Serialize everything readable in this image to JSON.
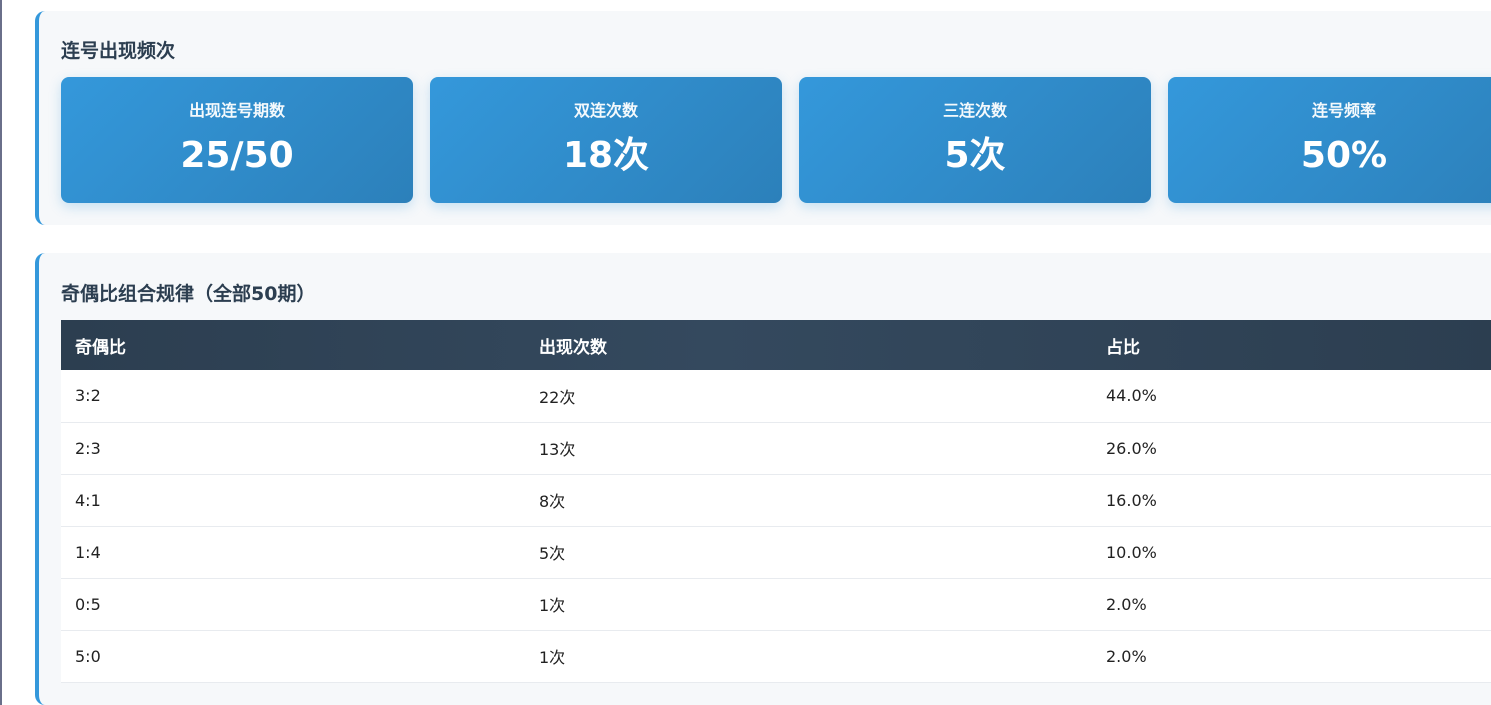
{
  "consecutive": {
    "title": "连号出现频次",
    "cards": [
      {
        "label": "出现连号期数",
        "value": "25/50"
      },
      {
        "label": "双连次数",
        "value": "18次"
      },
      {
        "label": "三连次数",
        "value": "5次"
      },
      {
        "label": "连号频率",
        "value": "50%"
      }
    ]
  },
  "parity": {
    "title": "奇偶比组合规律（全部50期）",
    "headers": [
      "奇偶比",
      "出现次数",
      "占比"
    ],
    "rows": [
      [
        "3:2",
        "22次",
        "44.0%"
      ],
      [
        "2:3",
        "13次",
        "26.0%"
      ],
      [
        "4:1",
        "8次",
        "16.0%"
      ],
      [
        "1:4",
        "5次",
        "10.0%"
      ],
      [
        "0:5",
        "1次",
        "2.0%"
      ],
      [
        "5:0",
        "1次",
        "2.0%"
      ]
    ]
  },
  "colors": {
    "accent": "#3498db",
    "header_dark": "#2c3e50",
    "section_bg": "#f6f8fa"
  }
}
